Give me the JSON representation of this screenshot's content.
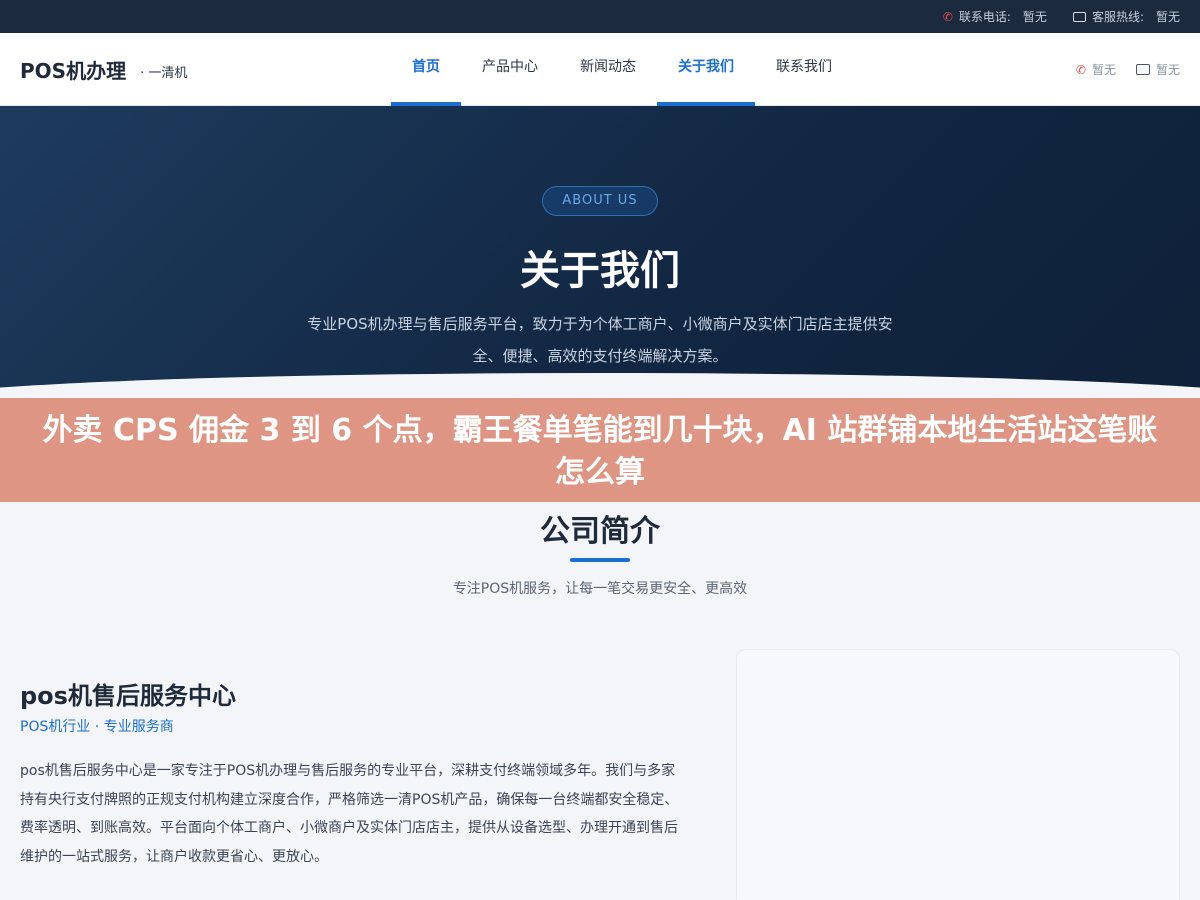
{
  "topbar": {
    "phone_label": "联系电话:",
    "phone_value": "暂无",
    "hotline_label": "客服热线:",
    "hotline_value": "暂无"
  },
  "header": {
    "logo": "POS机办理",
    "sublogo": "· 一清机",
    "nav": [
      {
        "label": "首页",
        "active": true
      },
      {
        "label": "产品中心",
        "active": false
      },
      {
        "label": "新闻动态",
        "active": false
      },
      {
        "label": "关于我们",
        "active": true
      },
      {
        "label": "联系我们",
        "active": false
      }
    ],
    "phone_value": "暂无",
    "chat_value": "暂无"
  },
  "hero": {
    "badge": "ABOUT US",
    "title": "关于我们",
    "desc": "专业POS机办理与售后服务平台，致力于为个体工商户、小微商户及实体门店店主提供安全、便捷、高效的支付终端解决方案。"
  },
  "banner": {
    "text": "外卖 CPS 佣金 3 到 6 个点，霸王餐单笔能到几十块，AI 站群铺本地生活站这笔账怎么算"
  },
  "section": {
    "title": "公司简介",
    "subtitle": "专注POS机服务，让每一笔交易更安全、更高效"
  },
  "company": {
    "name": "pos机售后服务中心",
    "tag": "POS机行业 · 专业服务商",
    "desc": "pos机售后服务中心是一家专注于POS机办理与售后服务的专业平台，深耕支付终端领域多年。我们与多家持有央行支付牌照的正规支付机构建立深度合作，严格筛选一清POS机产品，确保每一台终端都安全稳定、费率透明、到账高效。平台面向个体工商户、小微商户及实体门店店主，提供从设备选型、办理开通到售后维护的一站式服务，让商户收款更省心、更放心。"
  },
  "colors": {
    "accent": "#1a6fd1",
    "hero_dark": "#112641",
    "banner": "#df9583",
    "topbar": "#1b2a3c"
  }
}
